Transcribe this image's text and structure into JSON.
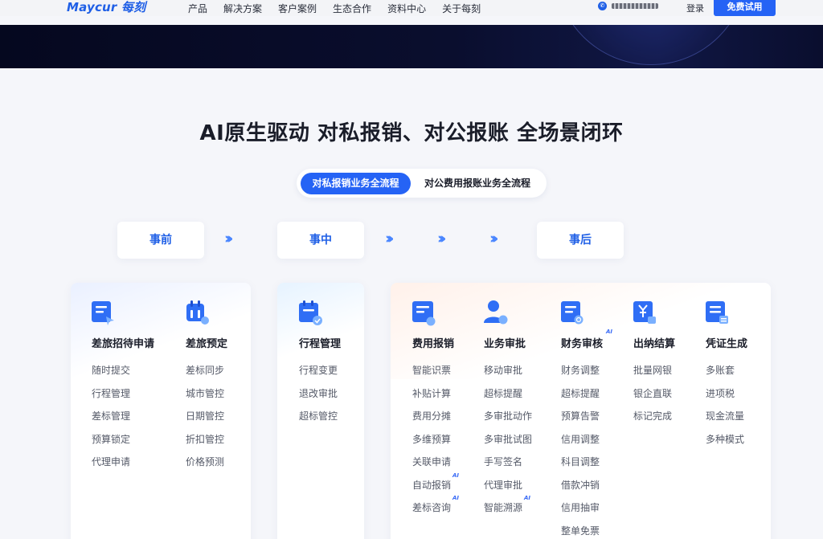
{
  "nav": {
    "logo_text": "Maycur 每刻",
    "items": [
      "产品",
      "解决方案",
      "客户案例",
      "生态合作",
      "资料中心",
      "关于每刻"
    ],
    "login_label": "登录",
    "trial_label": "免费试用"
  },
  "headline": "AI原生驱动 对私报销、对公报账 全场景闭环",
  "tabs": {
    "active": "对私报销业务全流程",
    "inactive": "对公费用报账业务全流程"
  },
  "stages": [
    "事前",
    "事中",
    "事后"
  ],
  "arrow_glyph": "›››",
  "ai_label": "AI",
  "columns": [
    {
      "title": "差旅招待申请",
      "icon": "travel-request-icon",
      "items": [
        "随时提交",
        "行程管理",
        "差标管理",
        "预算锁定",
        "代理申请"
      ]
    },
    {
      "title": "差旅预定",
      "icon": "travel-booking-icon",
      "items": [
        "差标同步",
        "城市管控",
        "日期管控",
        "折扣管控",
        "价格预测"
      ]
    },
    {
      "title": "行程管理",
      "icon": "itinerary-icon",
      "items": [
        "行程变更",
        "退改审批",
        "超标管控"
      ]
    },
    {
      "title": "费用报销",
      "icon": "expense-icon",
      "items": [
        "智能识票",
        "补贴计算",
        "费用分摊",
        "多维预算",
        "关联申请",
        "自动报销",
        "差标咨询"
      ]
    },
    {
      "title": "业务审批",
      "icon": "approval-icon",
      "items": [
        "移动审批",
        "超标提醒",
        "多审批动作",
        "多审批试图",
        "手写签名",
        "代理审批",
        "智能溯源"
      ]
    },
    {
      "title": "财务审核",
      "icon": "finance-audit-icon",
      "items": [
        "财务调整",
        "超标提醒",
        "预算告警",
        "信用调整",
        "科目调整",
        "借款冲销",
        "信用抽审",
        "整单免票"
      ]
    },
    {
      "title": "出纳结算",
      "icon": "cashier-icon",
      "items": [
        "批量网银",
        "银企直联",
        "标记完成"
      ]
    },
    {
      "title": "凭证生成",
      "icon": "voucher-icon",
      "items": [
        "多账套",
        "进项税",
        "现金流量",
        "多种模式"
      ]
    }
  ]
}
